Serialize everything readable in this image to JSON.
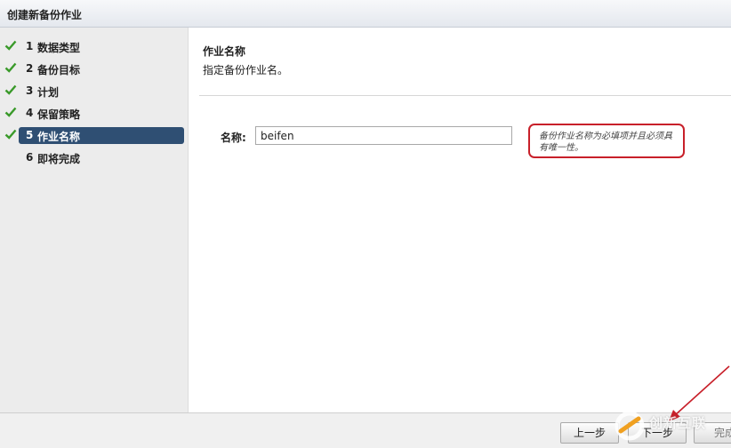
{
  "window": {
    "title": "创建新备份作业"
  },
  "steps": [
    {
      "num": "1",
      "label": "数据类型",
      "done": true
    },
    {
      "num": "2",
      "label": "备份目标",
      "done": true
    },
    {
      "num": "3",
      "label": "计划",
      "done": true
    },
    {
      "num": "4",
      "label": "保留策略",
      "done": true
    },
    {
      "num": "5",
      "label": "作业名称",
      "done": true,
      "active": true
    },
    {
      "num": "6",
      "label": "即将完成",
      "done": false
    }
  ],
  "main": {
    "title": "作业名称",
    "description": "指定备份作业名。",
    "name_label": "名称:",
    "name_value": "beifen",
    "tip": "备份作业名称为必填项并且必须具有唯一性。"
  },
  "footer": {
    "prev_label": "上一步",
    "next_label": "下一步",
    "finish_label": "完成"
  },
  "watermark": {
    "text": "创新互联"
  },
  "colors": {
    "active_step": "#2f4f73",
    "check": "#3a9a2a",
    "tip_border": "#c8202a",
    "arrow": "#c8202a"
  },
  "icons": {
    "done": "check-icon"
  }
}
